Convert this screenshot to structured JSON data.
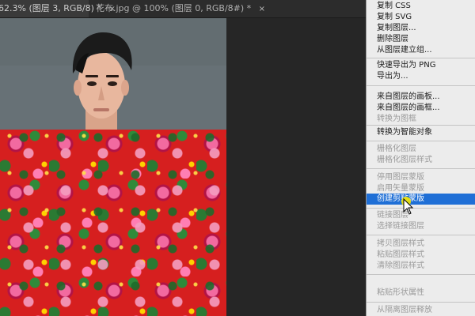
{
  "tabs": [
    {
      "label": "62.3% (图层 3, RGB/8) *",
      "close": "×"
    },
    {
      "label": "花布.jpg @ 100% (图层 0, RGB/8#) *",
      "close": "×"
    }
  ],
  "context_menu": {
    "items": [
      {
        "label": "复制 CSS",
        "enabled": true
      },
      {
        "label": "复制 SVG",
        "enabled": true
      },
      {
        "label": "复制图层...",
        "enabled": true
      },
      {
        "label": "删除图层",
        "enabled": true
      },
      {
        "label": "从图层建立组...",
        "enabled": true
      },
      {
        "label": "快速导出为 PNG",
        "enabled": true
      },
      {
        "label": "导出为...",
        "enabled": true
      },
      {
        "label": "来自图层的画板...",
        "enabled": true
      },
      {
        "label": "来自图层的画框...",
        "enabled": true
      },
      {
        "label": "转换为图框",
        "enabled": false
      },
      {
        "label": "转换为智能对象",
        "enabled": true
      },
      {
        "label": "栅格化图层",
        "enabled": false
      },
      {
        "label": "栅格化图层样式",
        "enabled": false
      },
      {
        "label": "停用图层蒙版",
        "enabled": false
      },
      {
        "label": "启用矢量蒙版",
        "enabled": false
      },
      {
        "label": "创建剪贴蒙版",
        "enabled": true,
        "highlighted": true
      },
      {
        "label": "链接图层",
        "enabled": false
      },
      {
        "label": "选择链接图层",
        "enabled": false
      },
      {
        "label": "拷贝图层样式",
        "enabled": false
      },
      {
        "label": "粘贴图层样式",
        "enabled": false
      },
      {
        "label": "清除图层样式",
        "enabled": false
      },
      {
        "label": "粘贴形状属性",
        "enabled": false
      },
      {
        "label": "从隔离图层释放",
        "enabled": false
      }
    ]
  },
  "colors": {
    "highlight": "#1f6fd6",
    "floral_red": "#d61f1f",
    "menu_bg": "#ececec"
  }
}
